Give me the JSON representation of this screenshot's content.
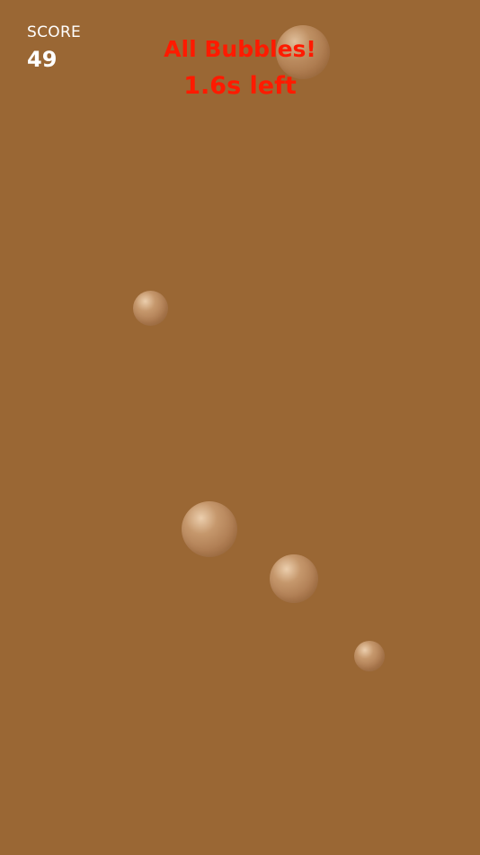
{
  "hud": {
    "score_label": "SCORE",
    "score_value": "49"
  },
  "banner": {
    "title": "All Bubbles!",
    "timer": "1.6s left"
  },
  "colors": {
    "background": "#9a6734",
    "banner_text": "#ff1a00",
    "hud_text": "#ffffff"
  }
}
